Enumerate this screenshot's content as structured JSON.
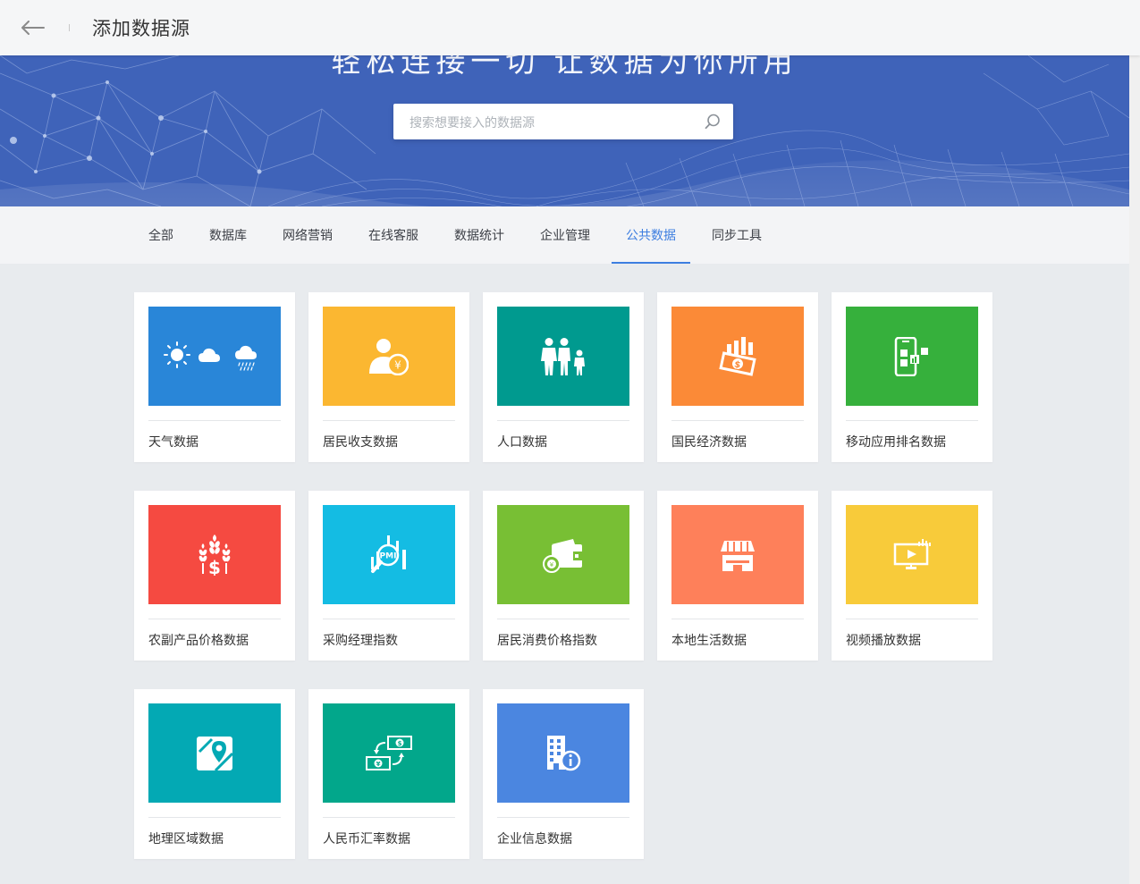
{
  "header": {
    "title": "添加数据源",
    "back_icon": "arrow-left-icon"
  },
  "hero": {
    "title": "轻松连接一切 让数据为你所用",
    "search_placeholder": "搜索想要接入的数据源",
    "search_value": "",
    "background_color": "#3f63b9"
  },
  "tabs": [
    {
      "label": "全部"
    },
    {
      "label": "数据库"
    },
    {
      "label": "网络营销"
    },
    {
      "label": "在线客服"
    },
    {
      "label": "数据统计"
    },
    {
      "label": "企业管理"
    },
    {
      "label": "公共数据",
      "active": true
    },
    {
      "label": "同步工具"
    }
  ],
  "accent_color": "#3d7ee0",
  "cards": [
    {
      "label": "天气数据",
      "color": "#2986d8",
      "icon": "weather-icon"
    },
    {
      "label": "居民收支数据",
      "color": "#fbb731",
      "icon": "person-yuan-icon"
    },
    {
      "label": "人口数据",
      "color": "#009a8f",
      "icon": "family-icon"
    },
    {
      "label": "国民经济数据",
      "color": "#fb8a37",
      "icon": "money-chart-icon"
    },
    {
      "label": "移动应用排名数据",
      "color": "#36b03c",
      "icon": "mobile-app-icon"
    },
    {
      "label": "农副产品价格数据",
      "color": "#f54a41",
      "icon": "wheat-dollar-icon"
    },
    {
      "label": "采购经理指数",
      "color": "#14bce3",
      "icon": "pmi-icon"
    },
    {
      "label": "居民消费价格指数",
      "color": "#78bf34",
      "icon": "wallet-icon"
    },
    {
      "label": "本地生活数据",
      "color": "#fe805a",
      "icon": "storefront-icon"
    },
    {
      "label": "视频播放数据",
      "color": "#f8cb3a",
      "icon": "video-screen-icon"
    },
    {
      "label": "地理区域数据",
      "color": "#03a9b4",
      "icon": "map-pin-icon"
    },
    {
      "label": "人民币汇率数据",
      "color": "#02a78b",
      "icon": "currency-exchange-icon"
    },
    {
      "label": "企业信息数据",
      "color": "#4b86e0",
      "icon": "building-info-icon"
    }
  ],
  "icon_text": {
    "pmi": "PMI",
    "dollar": "$",
    "yuan": "¥"
  }
}
